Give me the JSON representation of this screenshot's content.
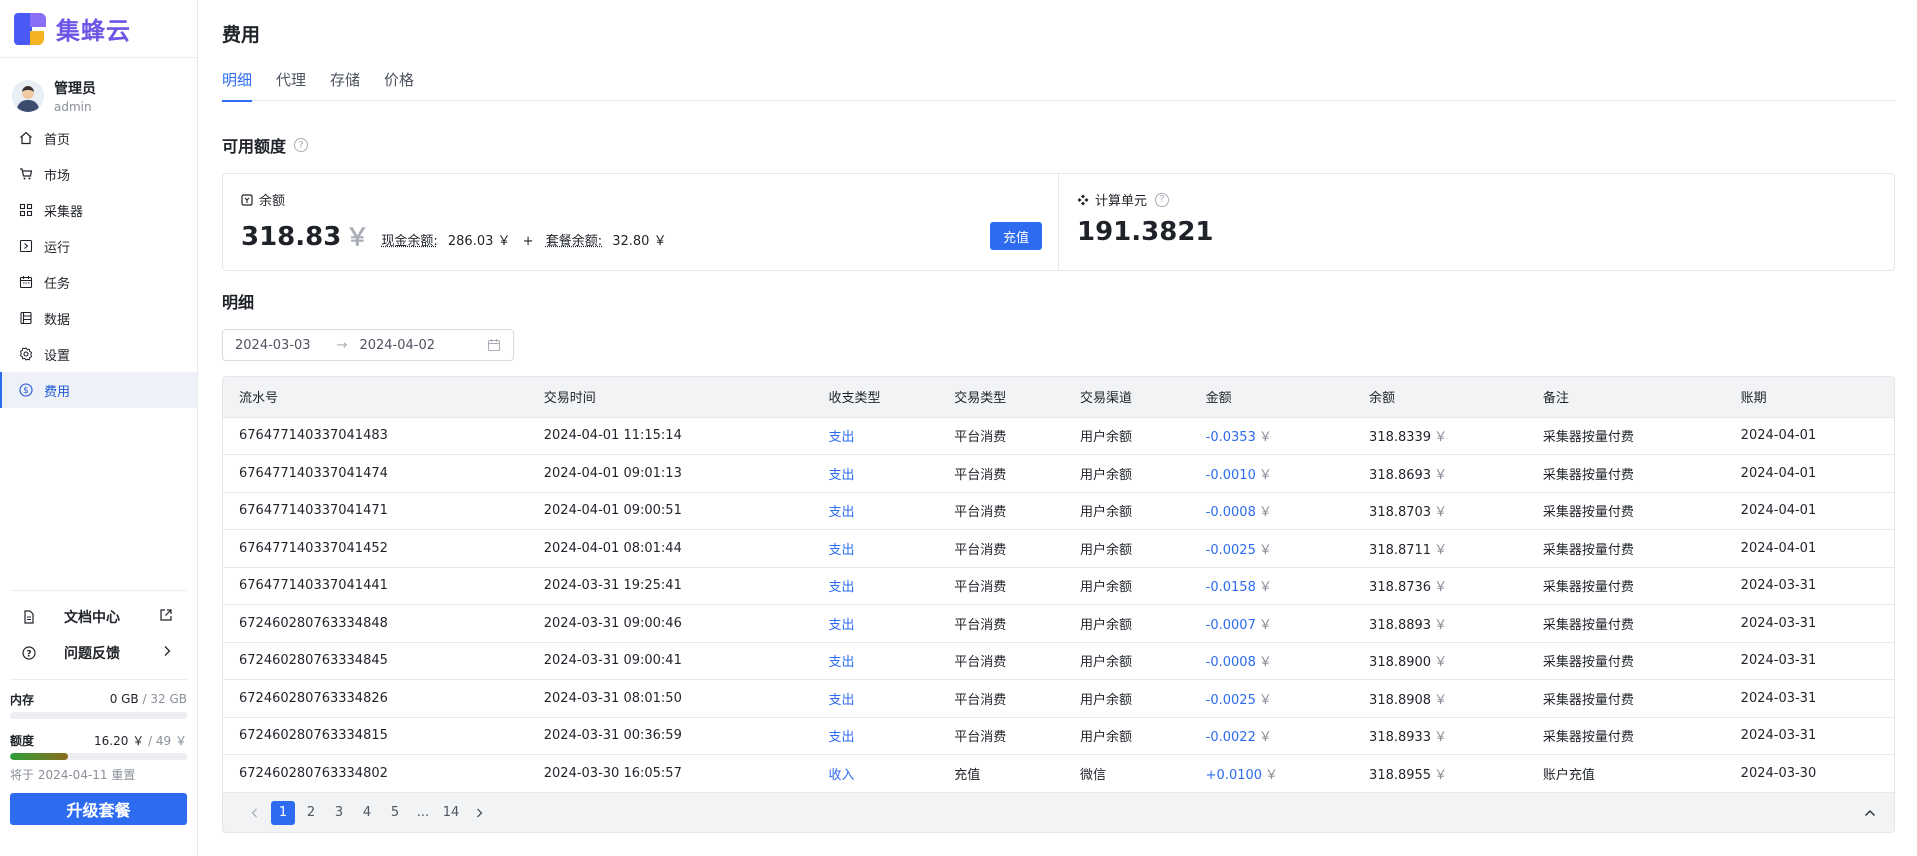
{
  "app": {
    "name": "集蜂云"
  },
  "user": {
    "name": "管理员",
    "sub": "admin"
  },
  "nav": [
    {
      "label": "首页",
      "icon": "home-icon"
    },
    {
      "label": "市场",
      "icon": "cart-icon"
    },
    {
      "label": "采集器",
      "icon": "collector-icon"
    },
    {
      "label": "运行",
      "icon": "run-icon"
    },
    {
      "label": "任务",
      "icon": "calendar-icon"
    },
    {
      "label": "数据",
      "icon": "data-icon"
    },
    {
      "label": "设置",
      "icon": "gear-icon"
    },
    {
      "label": "费用",
      "icon": "dollar-icon",
      "active": true
    }
  ],
  "side_links": {
    "docs": "文档中心",
    "feedback": "问题反馈"
  },
  "quota": {
    "memory_label": "内存",
    "memory_used": "0 GB",
    "memory_total": "32 GB",
    "memory_progress": 0,
    "budget_label": "额度",
    "budget_used": "16.20 ￥",
    "budget_total": "49 ￥",
    "budget_progress": 0.33,
    "reset_text": "将于 2024-04-11 重置",
    "upgrade_label": "升级套餐"
  },
  "page": {
    "title": "费用"
  },
  "tabs": [
    {
      "label": "明细",
      "active": true
    },
    {
      "label": "代理"
    },
    {
      "label": "存储"
    },
    {
      "label": "价格"
    }
  ],
  "available": {
    "title": "可用额度",
    "balance_label": "余额",
    "balance_value": "318.83",
    "currency": "￥",
    "cash_label": "现金余额:",
    "cash_value": "286.03 ￥",
    "plus": "+",
    "package_label": "套餐余额:",
    "package_value": "32.80 ￥",
    "recharge_label": "充值",
    "units_label": "计算单元",
    "units_value": "191.3821"
  },
  "details": {
    "title": "明细",
    "date_start": "2024-03-03",
    "date_end": "2024-04-02",
    "date_sep": "→"
  },
  "table": {
    "headers": [
      "流水号",
      "交易时间",
      "收支类型",
      "交易类型",
      "交易渠道",
      "金额",
      "余额",
      "备注",
      "账期"
    ],
    "rows": [
      [
        "676477140337041483",
        "2024-04-01 11:15:14",
        "支出",
        "平台消费",
        "用户余额",
        "-0.0353",
        "318.8339",
        "采集器按量付费",
        "2024-04-01"
      ],
      [
        "676477140337041474",
        "2024-04-01 09:01:13",
        "支出",
        "平台消费",
        "用户余额",
        "-0.0010",
        "318.8693",
        "采集器按量付费",
        "2024-04-01"
      ],
      [
        "676477140337041471",
        "2024-04-01 09:00:51",
        "支出",
        "平台消费",
        "用户余额",
        "-0.0008",
        "318.8703",
        "采集器按量付费",
        "2024-04-01"
      ],
      [
        "676477140337041452",
        "2024-04-01 08:01:44",
        "支出",
        "平台消费",
        "用户余额",
        "-0.0025",
        "318.8711",
        "采集器按量付费",
        "2024-04-01"
      ],
      [
        "676477140337041441",
        "2024-03-31 19:25:41",
        "支出",
        "平台消费",
        "用户余额",
        "-0.0158",
        "318.8736",
        "采集器按量付费",
        "2024-03-31"
      ],
      [
        "672460280763334848",
        "2024-03-31 09:00:46",
        "支出",
        "平台消费",
        "用户余额",
        "-0.0007",
        "318.8893",
        "采集器按量付费",
        "2024-03-31"
      ],
      [
        "672460280763334845",
        "2024-03-31 09:00:41",
        "支出",
        "平台消费",
        "用户余额",
        "-0.0008",
        "318.8900",
        "采集器按量付费",
        "2024-03-31"
      ],
      [
        "672460280763334826",
        "2024-03-31 08:01:50",
        "支出",
        "平台消费",
        "用户余额",
        "-0.0025",
        "318.8908",
        "采集器按量付费",
        "2024-03-31"
      ],
      [
        "672460280763334815",
        "2024-03-31 00:36:59",
        "支出",
        "平台消费",
        "用户余额",
        "-0.0022",
        "318.8933",
        "采集器按量付费",
        "2024-03-31"
      ],
      [
        "672460280763334802",
        "2024-03-30 16:05:57",
        "收入",
        "充值",
        "微信",
        "+0.0100",
        "318.8955",
        "账户充值",
        "2024-03-30"
      ]
    ],
    "currency": "￥"
  },
  "pager": {
    "pages": [
      "1",
      "2",
      "3",
      "4",
      "5",
      "...",
      "14"
    ],
    "current": "1"
  }
}
